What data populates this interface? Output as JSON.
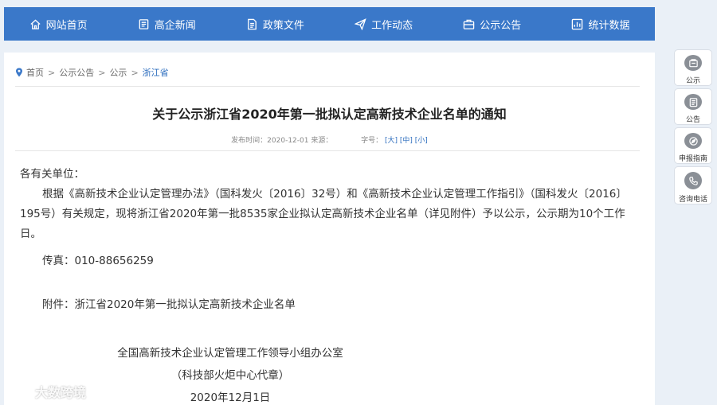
{
  "nav": {
    "items": [
      {
        "label": "网站首页",
        "icon": "home-icon"
      },
      {
        "label": "高企新闻",
        "icon": "news-icon"
      },
      {
        "label": "政策文件",
        "icon": "document-icon"
      },
      {
        "label": "工作动态",
        "icon": "send-icon"
      },
      {
        "label": "公示公告",
        "icon": "briefcase-icon"
      },
      {
        "label": "统计数据",
        "icon": "chart-icon"
      }
    ]
  },
  "breadcrumb": {
    "home": "首页",
    "level1": "公示公告",
    "level2": "公示",
    "current": "浙江省",
    "sep": ">"
  },
  "article": {
    "title": "关于公示浙江省2020年第一批拟认定高新技术企业名单的通知",
    "meta_date": "发布时间：2020-12-01 来源：",
    "meta_fontsize": "字号：",
    "font_large": "[大]",
    "font_medium": "[中]",
    "font_small": "[小]",
    "salutation": "各有关单位：",
    "paragraph": "根据《高新技术企业认定管理办法》（国科发火〔2016〕32号）和《高新技术企业认定管理工作指引》（国科发火〔2016〕195号）有关规定，现将浙江省2020年第一批8535家企业拟认定高新技术企业名单（详见附件）予以公示，公示期为10个工作日。",
    "fax": "传真：010-88656259",
    "attachment": "附件：浙江省2020年第一批拟认定高新技术企业名单",
    "signer": "全国高新技术企业认定管理工作领导小组办公室",
    "signer_note": "（科技部火炬中心代章）",
    "sign_date": "2020年12月1日"
  },
  "side_tools": [
    {
      "label": "公示",
      "icon": "notice-icon"
    },
    {
      "label": "公告",
      "icon": "announcement-icon"
    },
    {
      "label": "申报指南",
      "icon": "compass-icon"
    },
    {
      "label": "咨询电话",
      "icon": "phone-icon"
    }
  ],
  "watermark": {
    "text": "大数跨境"
  },
  "colors": {
    "nav_bg": "#3a78c9",
    "link": "#2f6fbf",
    "page_bg": "#eaf0f7"
  }
}
